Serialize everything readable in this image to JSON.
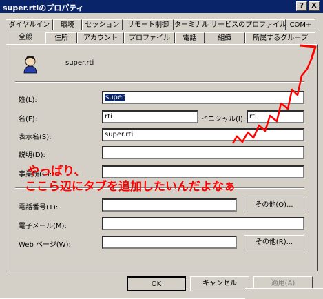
{
  "window": {
    "title": "super.rtiのプロパティ",
    "help_glyph": "?",
    "close_glyph": "X"
  },
  "tabs_row1": [
    "ダイヤルイン",
    "環境",
    "セッション",
    "リモート制御",
    "ターミナル サービスのプロファイル",
    "COM+"
  ],
  "tabs_row2": [
    "全般",
    "住所",
    "アカウント",
    "プロファイル",
    "電話",
    "組織",
    "所属するグループ"
  ],
  "general": {
    "user_name": "super.rti",
    "fields": {
      "last_name_label": "姓(L):",
      "last_name_value": "super",
      "first_name_label": "名(F):",
      "first_name_value": "rti",
      "initials_label": "イニシャル(I):",
      "initials_value": "rti",
      "display_name_label": "表示名(S):",
      "display_name_value": "super.rti",
      "description_label": "説明(D):",
      "description_value": "",
      "office_label": "事業所(C):",
      "office_value": "",
      "phone_label": "電話番号(T):",
      "phone_value": "",
      "email_label": "電子メール(M):",
      "email_value": "",
      "web_label": "Web ページ(W):",
      "web_value": ""
    },
    "other_button": "その他(O)...",
    "other_button2": "その他(R)..."
  },
  "buttons": {
    "ok": "OK",
    "cancel": "キャンセル",
    "apply": "適用(A)"
  },
  "annotation": {
    "line1": "やっぱり、",
    "line2": "ここら辺にタブを追加したいんだよなぁ",
    "color": "#ff0000"
  },
  "colors": {
    "titlebar": "#0a246a",
    "dialog_bg": "#d4d0c8",
    "annotation": "#ff0000"
  }
}
